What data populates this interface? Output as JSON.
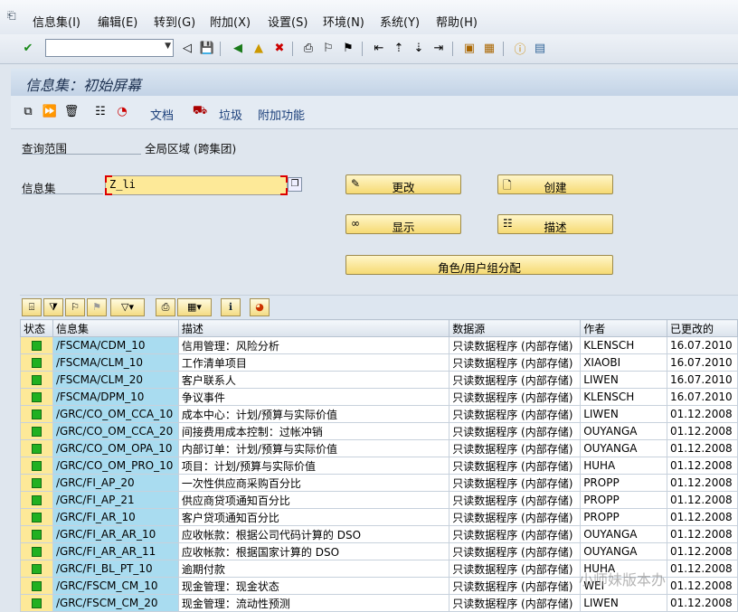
{
  "menubar": {
    "items": [
      "信息集(I)",
      "编辑(E)",
      "转到(G)",
      "附加(X)",
      "设置(S)",
      "环境(N)",
      "系统(Y)",
      "帮助(H)"
    ]
  },
  "toolbar": {
    "command_value": ""
  },
  "title": "信息集：初始屏幕",
  "app_toolbar": {
    "doc": "文档",
    "trash": "垃圾",
    "extras": "附加功能"
  },
  "form": {
    "scope_label": "查询范围",
    "scope_value": "全局区域 (跨集团)",
    "infoset_label": "信息集",
    "infoset_value": "Z_li"
  },
  "buttons": {
    "change": "更改",
    "create": "创建",
    "display": "显示",
    "describe": "描述",
    "role": "角色/用户组分配"
  },
  "table": {
    "headers": [
      "状态",
      "信息集",
      "描述",
      "数据源",
      "作者",
      "已更改的"
    ],
    "rows": [
      [
        "/FSCMA/CDM_10",
        "信用管理：风险分析",
        "只读数据程序 (内部存储)",
        "KLENSCH",
        "16.07.2010"
      ],
      [
        "/FSCMA/CLM_10",
        "工作清单项目",
        "只读数据程序 (内部存储)",
        "XIAOBI",
        "16.07.2010"
      ],
      [
        "/FSCMA/CLM_20",
        "客户联系人",
        "只读数据程序 (内部存储)",
        "LIWEN",
        "16.07.2010"
      ],
      [
        "/FSCMA/DPM_10",
        "争议事件",
        "只读数据程序 (内部存储)",
        "KLENSCH",
        "16.07.2010"
      ],
      [
        "/GRC/CO_OM_CCA_10",
        "成本中心：计划/预算与实际价值",
        "只读数据程序 (内部存储)",
        "LIWEN",
        "01.12.2008"
      ],
      [
        "/GRC/CO_OM_CCA_20",
        "间接费用成本控制：过帐冲销",
        "只读数据程序 (内部存储)",
        "OUYANGA",
        "01.12.2008"
      ],
      [
        "/GRC/CO_OM_OPA_10",
        "内部订单：计划/预算与实际价值",
        "只读数据程序 (内部存储)",
        "OUYANGA",
        "01.12.2008"
      ],
      [
        "/GRC/CO_OM_PRO_10",
        "项目：计划/预算与实际价值",
        "只读数据程序 (内部存储)",
        "HUHA",
        "01.12.2008"
      ],
      [
        "/GRC/FI_AP_20",
        "一次性供应商采购百分比",
        "只读数据程序 (内部存储)",
        "PROPP",
        "01.12.2008"
      ],
      [
        "/GRC/FI_AP_21",
        "供应商贷项通知百分比",
        "只读数据程序 (内部存储)",
        "PROPP",
        "01.12.2008"
      ],
      [
        "/GRC/FI_AR_10",
        "客户贷项通知百分比",
        "只读数据程序 (内部存储)",
        "PROPP",
        "01.12.2008"
      ],
      [
        "/GRC/FI_AR_AR_10",
        "应收帐款：根据公司代码计算的 DSO",
        "只读数据程序 (内部存储)",
        "OUYANGA",
        "01.12.2008"
      ],
      [
        "/GRC/FI_AR_AR_11",
        "应收帐款：根据国家计算的 DSO",
        "只读数据程序 (内部存储)",
        "OUYANGA",
        "01.12.2008"
      ],
      [
        "/GRC/FI_BL_PT_10",
        "逾期付款",
        "只读数据程序 (内部存储)",
        "HUHA",
        "01.12.2008"
      ],
      [
        "/GRC/FSCM_CM_10",
        "现金管理：现金状态",
        "只读数据程序 (内部存储)",
        "WEI",
        "01.12.2008"
      ],
      [
        "/GRC/FSCM_CM_20",
        "现金管理：流动性预测",
        "只读数据程序 (内部存储)",
        "LIWEN",
        "01.12.2008"
      ]
    ]
  },
  "watermark": "小师妹版本办"
}
